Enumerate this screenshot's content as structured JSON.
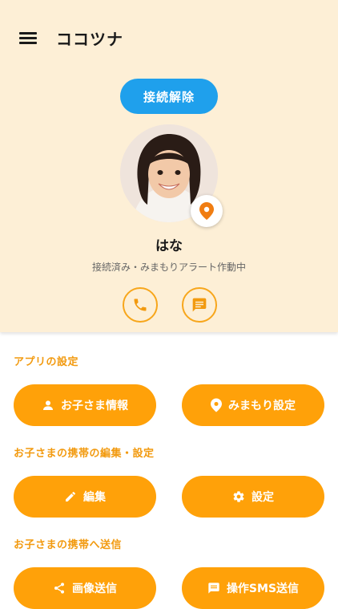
{
  "app": {
    "title": "ココツナ"
  },
  "header": {
    "disconnect_label": "接続解除"
  },
  "child": {
    "name": "はな",
    "status": "接続済み・みまもりアラート作動中"
  },
  "sections": [
    {
      "label": "アプリの設定",
      "buttons": [
        {
          "label": "お子さま情報",
          "icon": "person-icon"
        },
        {
          "label": "みまもり設定",
          "icon": "location-pin-icon"
        }
      ]
    },
    {
      "label": "お子さまの携帯の編集・設定",
      "buttons": [
        {
          "label": "編集",
          "icon": "pencil-icon"
        },
        {
          "label": "設定",
          "icon": "gear-icon"
        }
      ]
    },
    {
      "label": "お子さまの携帯へ送信",
      "buttons": [
        {
          "label": "画像送信",
          "icon": "share-icon"
        },
        {
          "label": "操作SMS送信",
          "icon": "message-icon"
        }
      ]
    }
  ],
  "colors": {
    "header_bg": "#fdefd6",
    "accent": "#ffa109",
    "disconnect": "#1fa0ec",
    "pin": "#f07d12"
  }
}
